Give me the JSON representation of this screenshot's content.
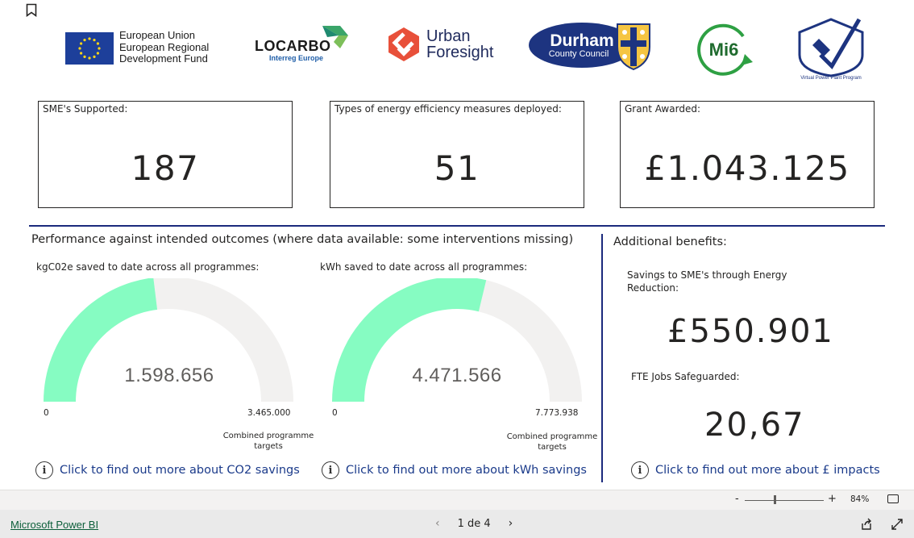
{
  "logos": {
    "eu_lines": [
      "European Union",
      "European Regional",
      "Development Fund"
    ],
    "locarbo": "LOCARBO",
    "locarbo_sub": "Interreg Europe",
    "urban_line1": "Urban",
    "urban_line2": "Foresight",
    "durham_line1": "Durham",
    "durham_line2": "County Council",
    "mi6": "Mi6",
    "vpp": "Virtual Power Plant Program"
  },
  "kpis": [
    {
      "label": "SME's Supported:",
      "value": "187"
    },
    {
      "label": "Types of energy efficiency measures deployed:",
      "value": "51"
    },
    {
      "label": "Grant Awarded:",
      "value": "£1.043.125"
    }
  ],
  "performance": {
    "title": "Performance against intended outcomes (where data available: some interventions missing)",
    "gauges": [
      {
        "label": "kgC02e saved to date across all programmes:",
        "value": "1.598.656",
        "min": "0",
        "max": "3.465.000",
        "target_label_1": "Combined programme",
        "target_label_2": "targets",
        "fraction": 0.4614,
        "fill_color": "#86fcc2",
        "track_color": "#f2f1f0"
      },
      {
        "label": "kWh saved to date across all programmes:",
        "value": "4.471.566",
        "min": "0",
        "max": "7.773.938",
        "target_label_1": "Combined programme",
        "target_label_2": "targets",
        "fraction": 0.5752,
        "fill_color": "#86fcc2",
        "track_color": "#f2f1f0"
      }
    ]
  },
  "benefits": {
    "title": "Additional benefits:",
    "savings_label": "Savings to SME's through Energy Reduction:",
    "savings_value": "£550.901",
    "fte_label": "FTE Jobs Safeguarded:",
    "fte_value": "20,67"
  },
  "links": {
    "co2": "Click to find out more about CO2 savings",
    "kwh": "Click to find out more about kWh savings",
    "impacts": "Click to find out more about £ impacts",
    "info_glyph": "i"
  },
  "statusbar": {
    "zoom_minus": "-",
    "zoom_plus": "+",
    "zoom": "84%",
    "zoom_fraction": 0.38
  },
  "footer": {
    "brand": "Microsoft Power BI",
    "page": "1 de 4",
    "prev": "‹",
    "next": "›"
  },
  "colors": {
    "accent": "#1b2a7d",
    "gauge_fill": "#86fcc2",
    "link": "#1a3a8a"
  }
}
